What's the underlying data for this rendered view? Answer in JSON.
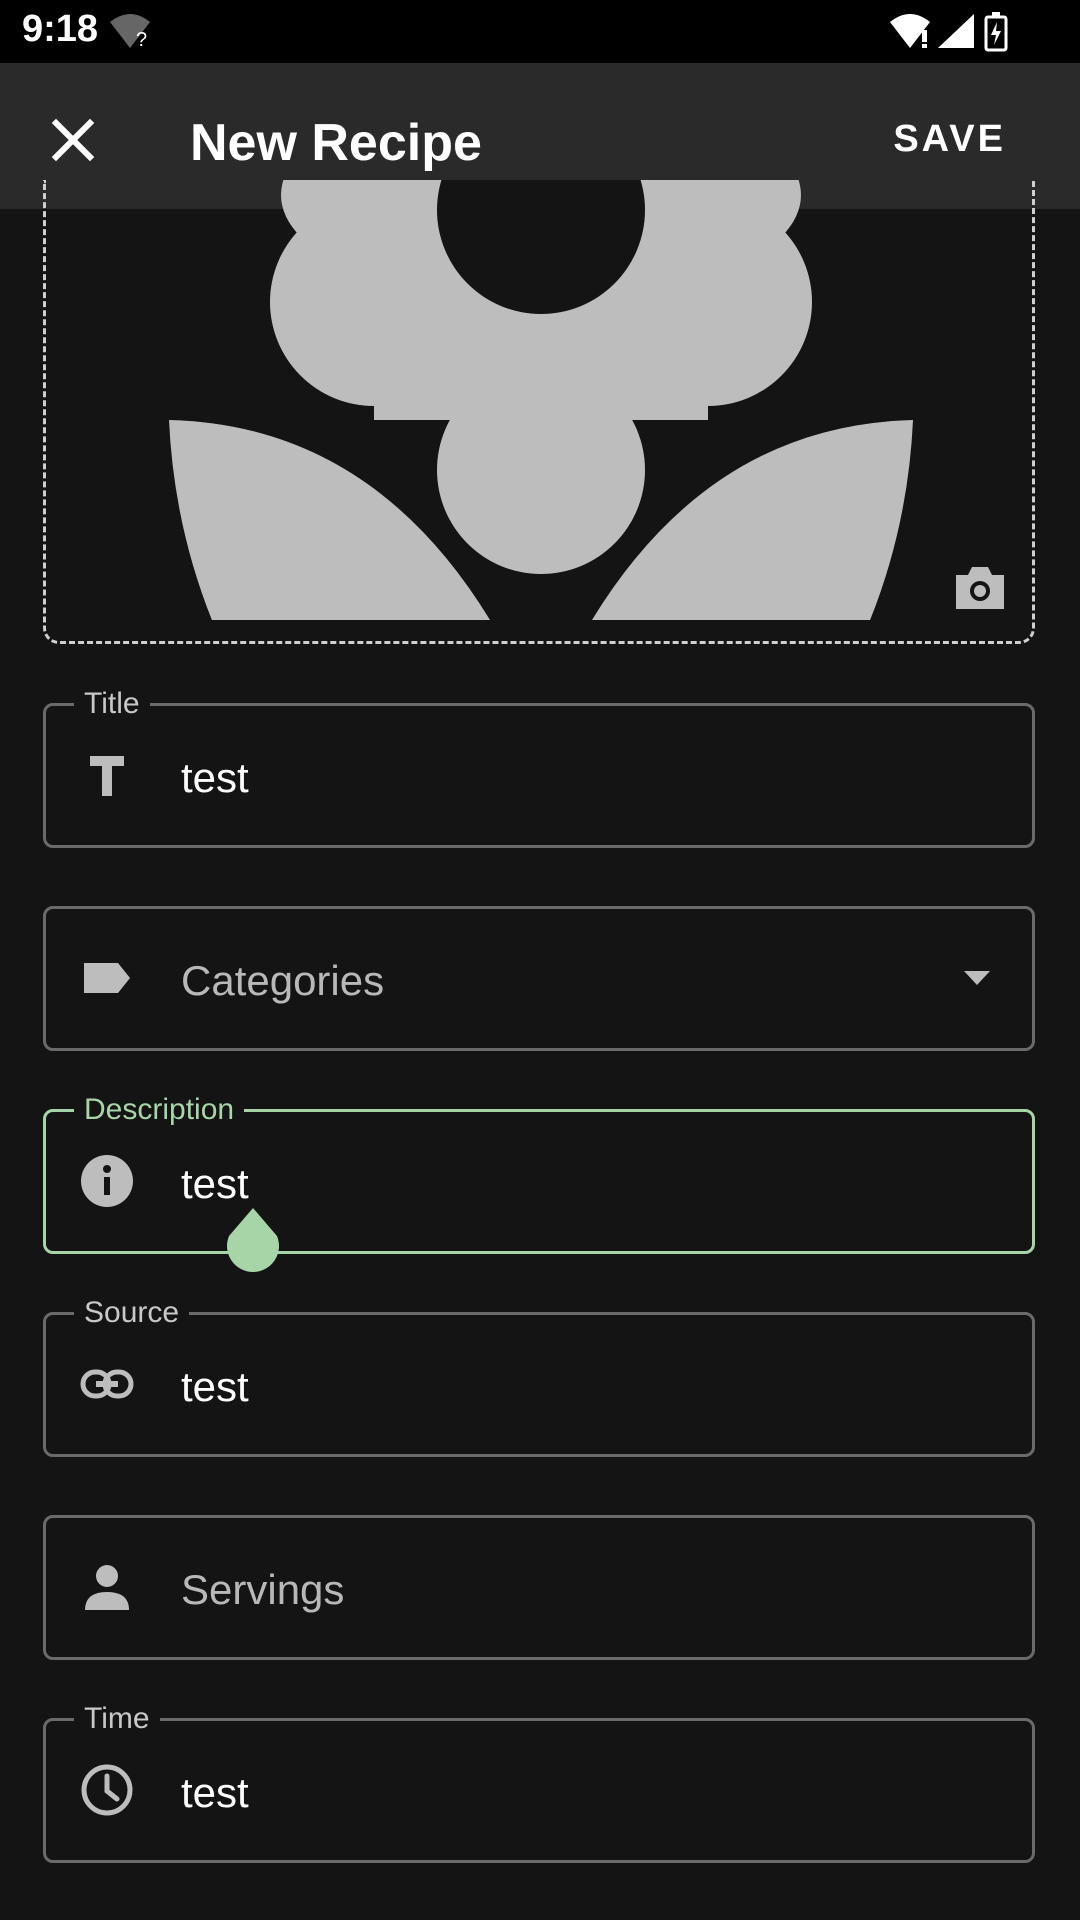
{
  "status_bar": {
    "time": "9:18",
    "icons": [
      "wifi-question-icon",
      "wifi-icon",
      "signal-icon",
      "battery-charging-icon"
    ]
  },
  "app_bar": {
    "title": "New Recipe",
    "save_label": "SAVE",
    "close_icon": "close-icon"
  },
  "image_picker": {
    "placeholder_icon": "flower-icon",
    "action_icon": "camera-icon"
  },
  "fields": {
    "title": {
      "label": "Title",
      "value": "test",
      "icon": "text-icon"
    },
    "categories": {
      "placeholder": "Categories",
      "icon": "label-icon",
      "dropdown_icon": "chevron-down-icon"
    },
    "description": {
      "label": "Description",
      "value": "test",
      "icon": "info-icon"
    },
    "source": {
      "label": "Source",
      "value": "test",
      "icon": "link-icon"
    },
    "servings": {
      "placeholder": "Servings",
      "icon": "person-icon"
    },
    "time": {
      "label": "Time",
      "value": "test",
      "icon": "clock-icon"
    }
  },
  "colors": {
    "background": "#141414",
    "app_bar": "#2a2a2a",
    "accent": "#a8d5a8",
    "border": "#6a6a6a",
    "icon_gray": "#bdbdbd"
  }
}
